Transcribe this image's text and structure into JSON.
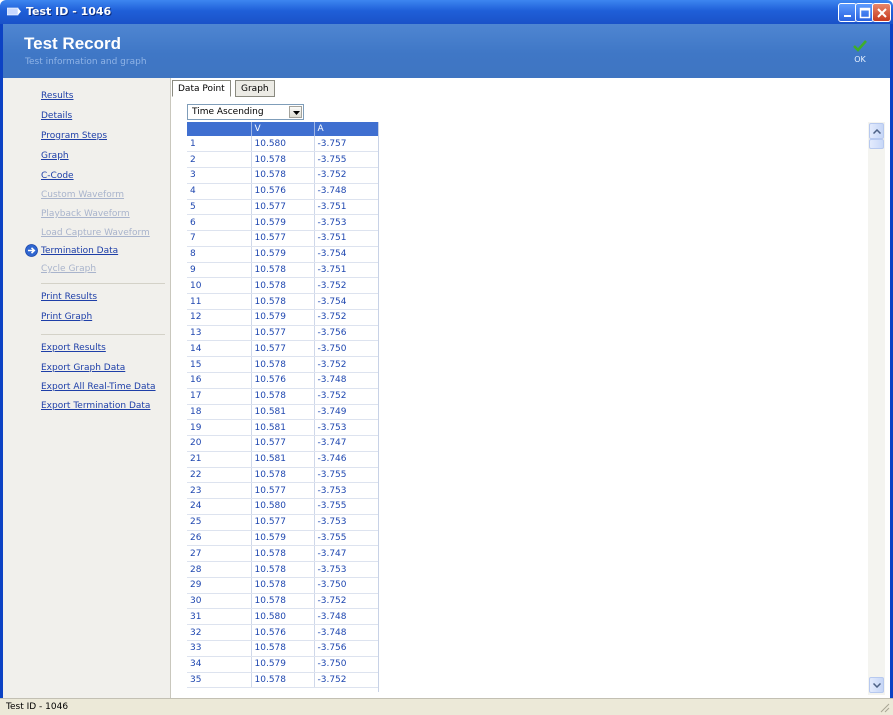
{
  "window": {
    "title": "Test ID - 1046"
  },
  "header": {
    "title": "Test Record",
    "subtitle": "Test information and graph",
    "ok_label": "OK"
  },
  "sidebar": {
    "group1": [
      {
        "label": "Results",
        "enabled": true
      },
      {
        "label": "Details",
        "enabled": true
      },
      {
        "label": "Program Steps",
        "enabled": true
      },
      {
        "label": "Graph",
        "enabled": true
      },
      {
        "label": "C-Code",
        "enabled": true
      },
      {
        "label": "Custom Waveform",
        "enabled": false
      },
      {
        "label": "Playback Waveform",
        "enabled": false
      },
      {
        "label": "Load Capture Waveform",
        "enabled": false
      },
      {
        "label": "Termination Data",
        "enabled": true,
        "current": true
      },
      {
        "label": "Cycle Graph",
        "enabled": false
      }
    ],
    "group2": [
      {
        "label": "Print Results"
      },
      {
        "label": "Print Graph"
      }
    ],
    "group3": [
      {
        "label": "Export Results"
      },
      {
        "label": "Export Graph Data"
      },
      {
        "label": "Export All Real-Time Data"
      },
      {
        "label": "Export Termination Data"
      }
    ]
  },
  "tabs": [
    {
      "label": "Data Point",
      "active": true
    },
    {
      "label": "Graph",
      "active": false
    }
  ],
  "sort_select": {
    "value": "Time Ascending"
  },
  "table": {
    "columns": [
      "",
      "V",
      "A"
    ],
    "rows": [
      [
        "1",
        "10.580",
        "-3.757"
      ],
      [
        "2",
        "10.578",
        "-3.755"
      ],
      [
        "3",
        "10.578",
        "-3.752"
      ],
      [
        "4",
        "10.576",
        "-3.748"
      ],
      [
        "5",
        "10.577",
        "-3.751"
      ],
      [
        "6",
        "10.579",
        "-3.753"
      ],
      [
        "7",
        "10.577",
        "-3.751"
      ],
      [
        "8",
        "10.579",
        "-3.754"
      ],
      [
        "9",
        "10.578",
        "-3.751"
      ],
      [
        "10",
        "10.578",
        "-3.752"
      ],
      [
        "11",
        "10.578",
        "-3.754"
      ],
      [
        "12",
        "10.579",
        "-3.752"
      ],
      [
        "13",
        "10.577",
        "-3.756"
      ],
      [
        "14",
        "10.577",
        "-3.750"
      ],
      [
        "15",
        "10.578",
        "-3.752"
      ],
      [
        "16",
        "10.576",
        "-3.748"
      ],
      [
        "17",
        "10.578",
        "-3.752"
      ],
      [
        "18",
        "10.581",
        "-3.749"
      ],
      [
        "19",
        "10.581",
        "-3.753"
      ],
      [
        "20",
        "10.577",
        "-3.747"
      ],
      [
        "21",
        "10.581",
        "-3.746"
      ],
      [
        "22",
        "10.578",
        "-3.755"
      ],
      [
        "23",
        "10.577",
        "-3.753"
      ],
      [
        "24",
        "10.580",
        "-3.755"
      ],
      [
        "25",
        "10.577",
        "-3.753"
      ],
      [
        "26",
        "10.579",
        "-3.755"
      ],
      [
        "27",
        "10.578",
        "-3.747"
      ],
      [
        "28",
        "10.578",
        "-3.753"
      ],
      [
        "29",
        "10.578",
        "-3.750"
      ],
      [
        "30",
        "10.578",
        "-3.752"
      ],
      [
        "31",
        "10.580",
        "-3.748"
      ],
      [
        "32",
        "10.576",
        "-3.748"
      ],
      [
        "33",
        "10.578",
        "-3.756"
      ],
      [
        "34",
        "10.579",
        "-3.750"
      ],
      [
        "35",
        "10.578",
        "-3.752"
      ]
    ]
  },
  "statusbar": {
    "text": "Test ID - 1046"
  },
  "colors": {
    "accent": "#3f6fd0",
    "header_bg": "#3f77c6",
    "link": "#1e3fa8",
    "title_bar": "#1f5fd8"
  }
}
